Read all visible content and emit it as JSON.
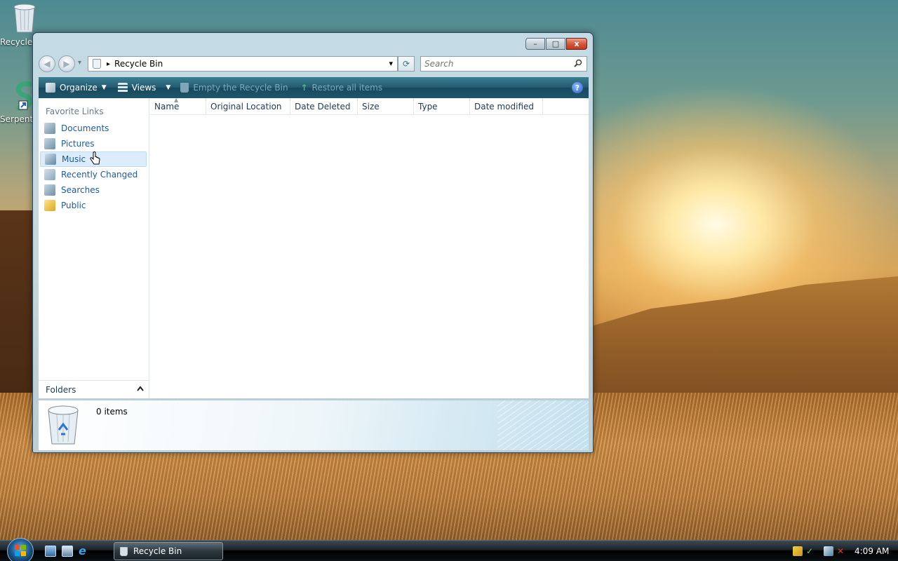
{
  "desktop": {
    "icons": [
      {
        "label": "Recycle Bin",
        "icon": "recycle-bin-icon"
      },
      {
        "label": "Serpent",
        "icon": "serpent-app-icon"
      }
    ]
  },
  "window": {
    "title": "Recycle Bin",
    "caption_buttons": {
      "minimize": "–",
      "maximize": "□",
      "close": "x"
    }
  },
  "nav": {
    "back": "◀",
    "forward": "▶",
    "address": "Recycle Bin",
    "address_separator": "▸",
    "dropdown": "▾",
    "refresh": "⟳",
    "search_placeholder": "Search"
  },
  "toolbar": {
    "organize": "Organize",
    "views": "Views",
    "empty_bin": "Empty the Recycle Bin",
    "restore_all": "Restore all items",
    "help": "?"
  },
  "favorite_links": {
    "title": "Favorite Links",
    "items": [
      {
        "label": "Documents",
        "icon": "documents-icon"
      },
      {
        "label": "Pictures",
        "icon": "pictures-icon"
      },
      {
        "label": "Music",
        "icon": "music-icon",
        "hovered": true
      },
      {
        "label": "Recently Changed",
        "icon": "recently-changed-icon"
      },
      {
        "label": "Searches",
        "icon": "searches-icon"
      },
      {
        "label": "Public",
        "icon": "public-folder-icon"
      }
    ]
  },
  "folders": {
    "label": "Folders",
    "chevron": "^"
  },
  "columns": [
    "Name",
    "Original Location",
    "Date Deleted",
    "Size",
    "Type",
    "Date modified"
  ],
  "details": {
    "item_count": "0 items"
  },
  "taskbar": {
    "task_button": "Recycle Bin",
    "clock": "4:09 AM"
  },
  "colors": {
    "toolbar": "#245c72",
    "link": "#1c5a9c",
    "hover": "#dcecfc"
  }
}
